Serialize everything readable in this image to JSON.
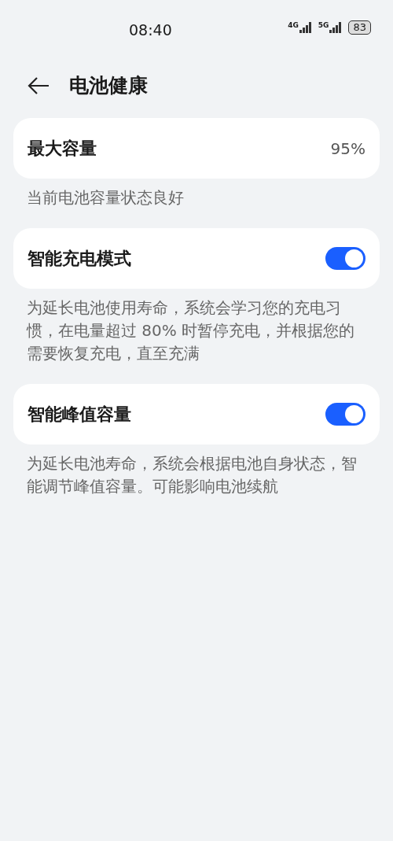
{
  "status_bar": {
    "time": "08:40",
    "network_1": "4G",
    "network_2": "5G",
    "battery": "83"
  },
  "header": {
    "title": "电池健康"
  },
  "sections": [
    {
      "kind": "value",
      "label": "最大容量",
      "value": "95%",
      "description": "当前电池容量状态良好"
    },
    {
      "kind": "toggle",
      "label": "智能充电模式",
      "on": true,
      "description": "为延长电池使用寿命，系统会学习您的充电习惯，在电量超过 80% 时暂停充电，并根据您的需要恢复充电，直至充满"
    },
    {
      "kind": "toggle",
      "label": "智能峰值容量",
      "on": true,
      "description": "为延长电池寿命，系统会根据电池自身状态，智能调节峰值容量。可能影响电池续航"
    }
  ]
}
